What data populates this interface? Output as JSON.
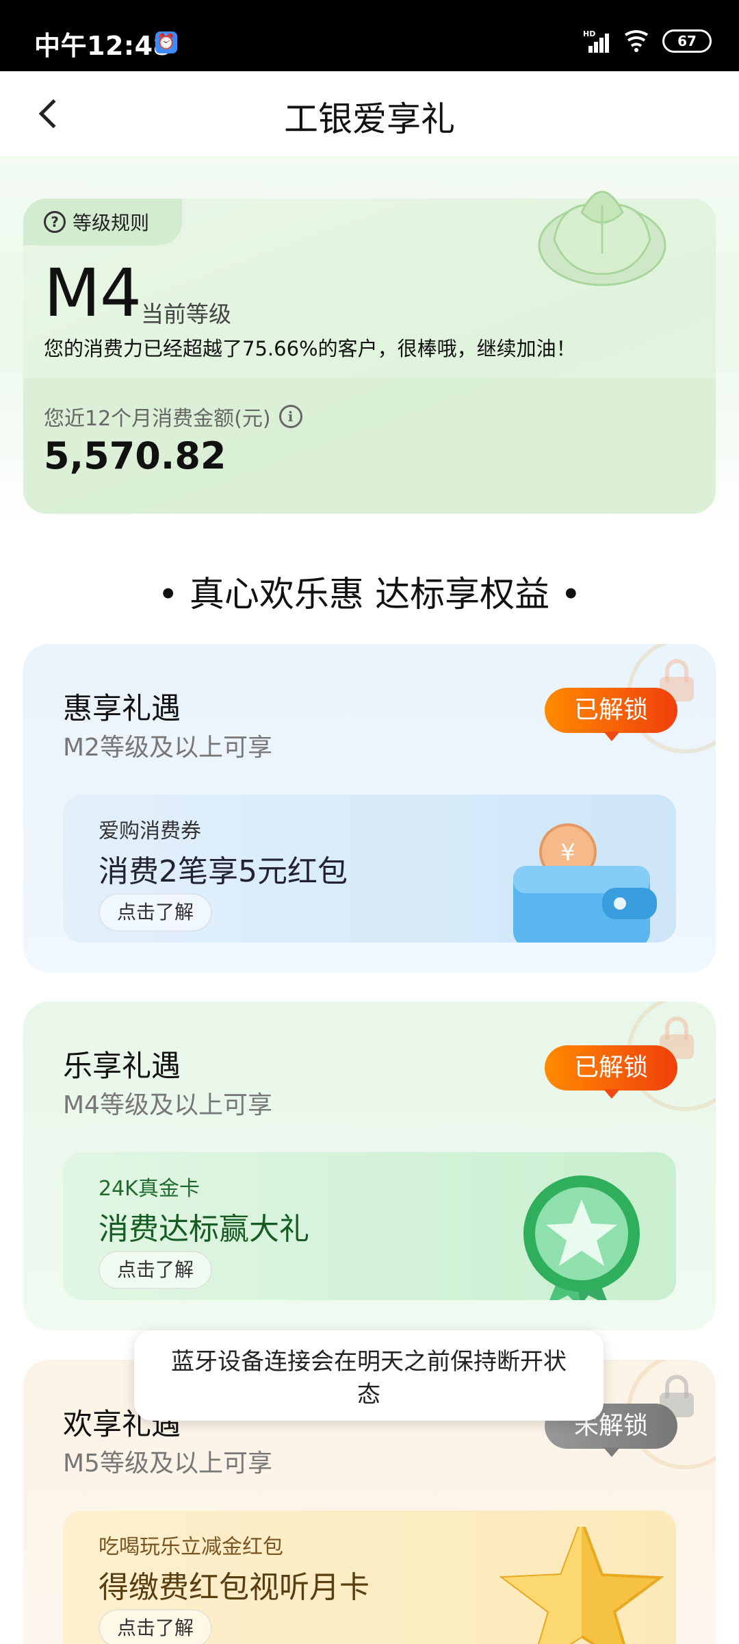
{
  "status_bar": {
    "time": "中午12:48",
    "alarm_glyph": "⏰",
    "signal_label": "HD",
    "battery": "67"
  },
  "nav": {
    "title": "工银爱享礼",
    "back_icon": "chevron-left-icon"
  },
  "level": {
    "rules_label": "等级规则",
    "rules_icon": "?",
    "code": "M4",
    "current_label": "当前等级",
    "description": "您的消费力已经超越了75.66%的客户，很棒哦，继续加油！",
    "spend_label": "您近12个月消费金额(元)",
    "info_icon": "i",
    "spend_amount": "5,570.82"
  },
  "section_title": "• 真心欢乐惠 达标享权益 •",
  "tiers": [
    {
      "name": "惠享礼遇",
      "requirement": "M2等级及以上可享",
      "status": "已解锁",
      "perk": {
        "tag": "爱购消费券",
        "title": "消费2笔享5元红包",
        "button": "点击了解"
      }
    },
    {
      "name": "乐享礼遇",
      "requirement": "M4等级及以上可享",
      "status": "已解锁",
      "perk": {
        "tag": "24K真金卡",
        "title": "消费达标赢大礼",
        "button": "点击了解"
      }
    },
    {
      "name": "欢享礼遇",
      "requirement": "M5等级及以上可享",
      "status": "未解锁",
      "perk": {
        "tag": "吃喝玩乐立减金红包",
        "title": "得缴费红包视听月卡",
        "button": "点击了解"
      }
    }
  ],
  "toast": {
    "message": "蓝牙设备连接会在明天之前保持断开状态"
  },
  "colors": {
    "unlocked_badge": "#f0400c",
    "locked_badge": "#888888",
    "level_card": "#dff3dc"
  }
}
